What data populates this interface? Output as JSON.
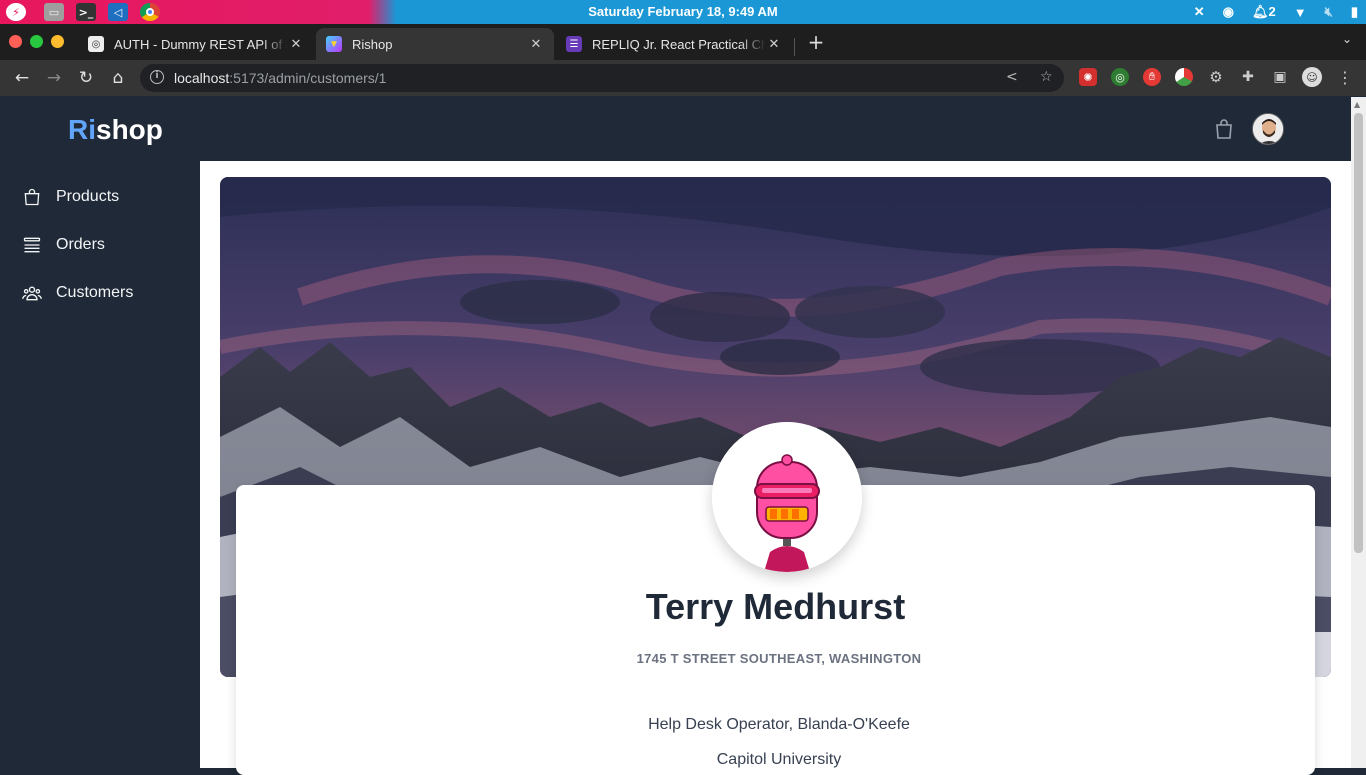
{
  "os": {
    "clock": "Saturday February 18,  9:49 AM",
    "notifications": "2"
  },
  "browser": {
    "tabs": [
      {
        "title": "AUTH - Dummy REST API of JS",
        "favicon": "globe-icon"
      },
      {
        "title": "Rishop",
        "favicon": "vite-icon"
      },
      {
        "title": "REPLIQ Jr. React Practical Cha",
        "favicon": "form-icon"
      }
    ],
    "url_host": "localhost",
    "url_path": ":5173/admin/customers/1"
  },
  "app": {
    "logo_prefix": "Ri",
    "logo_suffix": "shop",
    "colors": {
      "accent": "#60a5fa",
      "sidebar_bg": "#1f2937"
    }
  },
  "sidebar": {
    "items": [
      {
        "label": "Products",
        "icon": "shopping-bag-icon"
      },
      {
        "label": "Orders",
        "icon": "list-icon"
      },
      {
        "label": "Customers",
        "icon": "users-icon"
      }
    ]
  },
  "profile": {
    "name": "Terry Medhurst",
    "address": "1745 T STREET SOUTHEAST, WASHINGTON",
    "job": "Help Desk Operator, Blanda-O'Keefe",
    "university": "Capitol University"
  }
}
